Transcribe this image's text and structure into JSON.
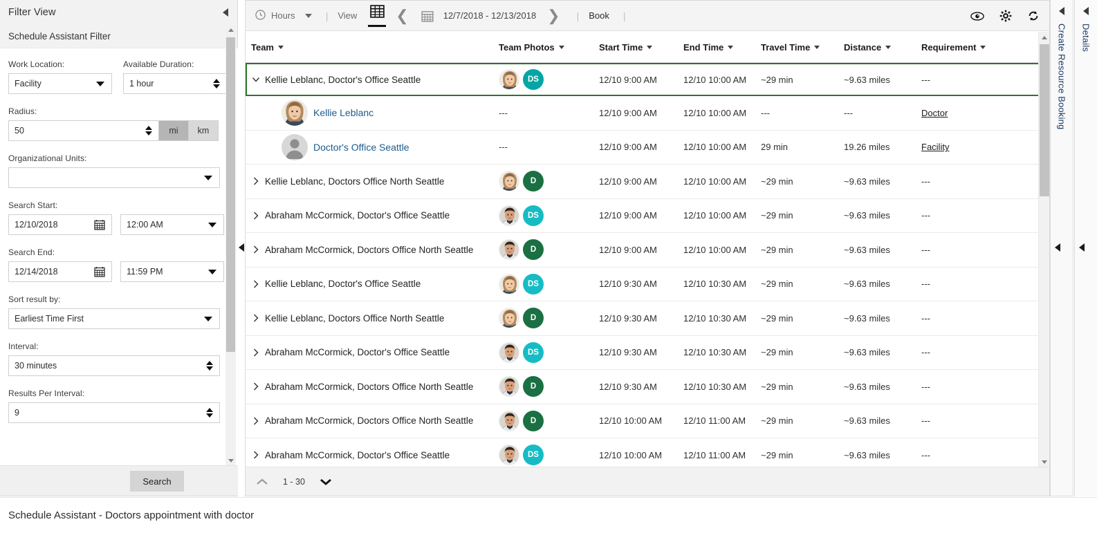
{
  "filter_panel": {
    "header_title": "Filter View",
    "subheader_title": "Schedule Assistant Filter",
    "fields": {
      "work_location_label": "Work Location:",
      "work_location_value": "Facility",
      "available_duration_label": "Available Duration:",
      "available_duration_value": "1 hour",
      "radius_label": "Radius:",
      "radius_value": "50",
      "unit_mi": "mi",
      "unit_km": "km",
      "org_units_label": "Organizational Units:",
      "org_units_value": "",
      "search_start_label": "Search Start:",
      "search_start_date": "12/10/2018",
      "search_start_time": "12:00 AM",
      "search_end_label": "Search End:",
      "search_end_date": "12/14/2018",
      "search_end_time": "11:59 PM",
      "sort_label": "Sort result by:",
      "sort_value": "Earliest Time First",
      "interval_label": "Interval:",
      "interval_value": "30 minutes",
      "results_per_interval_label": "Results Per Interval:",
      "results_per_interval_value": "9"
    },
    "search_button": "Search"
  },
  "toolbar": {
    "hours_label": "Hours",
    "sep": "|",
    "view_label": "View",
    "date_range": "12/7/2018 - 12/13/2018",
    "book_label": "Book"
  },
  "grid": {
    "columns": [
      {
        "key": "team",
        "label": "Team"
      },
      {
        "key": "photos",
        "label": "Team Photos"
      },
      {
        "key": "start",
        "label": "Start Time"
      },
      {
        "key": "end",
        "label": "End Time"
      },
      {
        "key": "travel",
        "label": "Travel Time"
      },
      {
        "key": "distance",
        "label": "Distance"
      },
      {
        "key": "requirement",
        "label": "Requirement"
      }
    ],
    "rows": [
      {
        "type": "group",
        "selected": true,
        "expanded": true,
        "team": "Kellie Leblanc, Doctor's Office Seattle",
        "badge": "DS",
        "badge_color": "#03a5a5",
        "avatar": "woman",
        "start": "12/10 9:00 AM",
        "end": "12/10 10:00 AM",
        "travel": "~29 min",
        "distance": "~9.63 miles",
        "requirement": "---"
      },
      {
        "type": "child",
        "team": "Kellie Leblanc",
        "avatar": "woman",
        "photos": "---",
        "start": "12/10 9:00 AM",
        "end": "12/10 10:00 AM",
        "travel": "---",
        "distance": "---",
        "requirement": "Doctor"
      },
      {
        "type": "child",
        "team": "Doctor's Office Seattle",
        "avatar": "generic",
        "photos": "---",
        "start": "12/10 9:00 AM",
        "end": "12/10 10:00 AM",
        "travel": "29 min",
        "distance": "19.26 miles",
        "requirement": "Facility"
      },
      {
        "type": "group",
        "selected": false,
        "expanded": false,
        "team": "Kellie Leblanc, Doctors Office North Seattle",
        "badge": "D",
        "badge_color": "#1a7043",
        "avatar": "woman",
        "start": "12/10 9:00 AM",
        "end": "12/10 10:00 AM",
        "travel": "~29 min",
        "distance": "~9.63 miles",
        "requirement": "---"
      },
      {
        "type": "group",
        "selected": false,
        "expanded": false,
        "team": "Abraham McCormick, Doctor's Office Seattle",
        "badge": "DS",
        "badge_color": "#16bcc4",
        "avatar": "man",
        "start": "12/10 9:00 AM",
        "end": "12/10 10:00 AM",
        "travel": "~29 min",
        "distance": "~9.63 miles",
        "requirement": "---"
      },
      {
        "type": "group",
        "selected": false,
        "expanded": false,
        "team": "Abraham McCormick, Doctors Office North Seattle",
        "badge": "D",
        "badge_color": "#1a7043",
        "avatar": "man",
        "start": "12/10 9:00 AM",
        "end": "12/10 10:00 AM",
        "travel": "~29 min",
        "distance": "~9.63 miles",
        "requirement": "---"
      },
      {
        "type": "group",
        "selected": false,
        "expanded": false,
        "team": "Kellie Leblanc, Doctor's Office Seattle",
        "badge": "DS",
        "badge_color": "#16bcc4",
        "avatar": "woman",
        "start": "12/10 9:30 AM",
        "end": "12/10 10:30 AM",
        "travel": "~29 min",
        "distance": "~9.63 miles",
        "requirement": "---"
      },
      {
        "type": "group",
        "selected": false,
        "expanded": false,
        "team": "Kellie Leblanc, Doctors Office North Seattle",
        "badge": "D",
        "badge_color": "#1a7043",
        "avatar": "woman",
        "start": "12/10 9:30 AM",
        "end": "12/10 10:30 AM",
        "travel": "~29 min",
        "distance": "~9.63 miles",
        "requirement": "---"
      },
      {
        "type": "group",
        "selected": false,
        "expanded": false,
        "team": "Abraham McCormick, Doctor's Office Seattle",
        "badge": "DS",
        "badge_color": "#16bcc4",
        "avatar": "man",
        "start": "12/10 9:30 AM",
        "end": "12/10 10:30 AM",
        "travel": "~29 min",
        "distance": "~9.63 miles",
        "requirement": "---"
      },
      {
        "type": "group",
        "selected": false,
        "expanded": false,
        "team": "Abraham McCormick, Doctors Office North Seattle",
        "badge": "D",
        "badge_color": "#1a7043",
        "avatar": "man",
        "start": "12/10 9:30 AM",
        "end": "12/10 10:30 AM",
        "travel": "~29 min",
        "distance": "~9.63 miles",
        "requirement": "---"
      },
      {
        "type": "group",
        "selected": false,
        "expanded": false,
        "team": "Abraham McCormick, Doctors Office North Seattle",
        "badge": "D",
        "badge_color": "#1a7043",
        "avatar": "man",
        "start": "12/10 10:00 AM",
        "end": "12/10 11:00 AM",
        "travel": "~29 min",
        "distance": "~9.63 miles",
        "requirement": "---"
      },
      {
        "type": "group",
        "selected": false,
        "expanded": false,
        "team": "Abraham McCormick, Doctor's Office Seattle",
        "badge": "DS",
        "badge_color": "#16bcc4",
        "avatar": "man",
        "start": "12/10 10:00 AM",
        "end": "12/10 11:00 AM",
        "travel": "~29 min",
        "distance": "~9.63 miles",
        "requirement": "---"
      }
    ]
  },
  "pager": {
    "range_label": "1 - 30"
  },
  "rails": {
    "booking_label": "Create Resource Booking",
    "details_label": "Details"
  },
  "status_bar": {
    "text": "Schedule Assistant - Doctors appointment with doctor"
  },
  "colors": {
    "selected_row_border": "#2e7330",
    "badge_teal": "#16bcc4",
    "badge_teal_dark": "#03a5a5",
    "badge_green": "#1a7043",
    "link_blue": "#1c5b8c",
    "panel_bg": "#f2f2f2"
  }
}
